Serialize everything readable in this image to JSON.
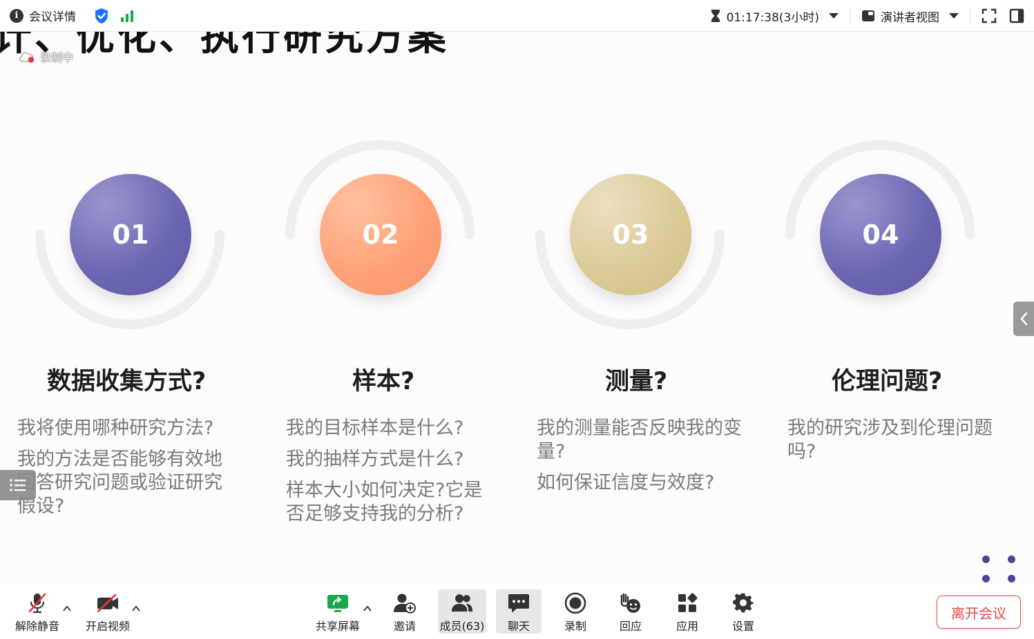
{
  "topbar": {
    "meeting_details": "会议详情",
    "timer": "01:17:38(3小时)",
    "view_mode": "演讲者视图"
  },
  "slide": {
    "title": "计、优化、执行研究方案",
    "recording_status": "录制中",
    "steps": [
      {
        "number": "01",
        "color": "#6d68b3",
        "title": "数据收集方式?",
        "questions": [
          "我将使用哪种研究方法?",
          "我的方法是否能够有效地回答研究问题或验证研究假设?"
        ]
      },
      {
        "number": "02",
        "color": "#ffa27a",
        "title": "样本?",
        "questions": [
          "我的目标样本是什么?",
          "我的抽样方式是什么?",
          "样本大小如何决定?它是否足够支持我的分析?"
        ]
      },
      {
        "number": "03",
        "color": "#dccb98",
        "title": "测量?",
        "questions": [
          "我的测量能否反映我的变量?",
          "如何保证信度与效度?"
        ]
      },
      {
        "number": "04",
        "color": "#6d68b3",
        "title": "伦理问题?",
        "questions": [
          "我的研究涉及到伦理问题吗?"
        ]
      }
    ]
  },
  "toolbar": {
    "unmute": "解除静音",
    "start_video": "开启视频",
    "share_screen": "共享屏幕",
    "invite": "邀请",
    "members": "成员(63)",
    "chat": "聊天",
    "record": "录制",
    "reactions": "回应",
    "apps": "应用",
    "settings": "设置",
    "leave": "离开会议"
  },
  "colors": {
    "share_green": "#1aa84b",
    "alert_red": "#e04848",
    "brand_blue": "#1e6fff"
  }
}
